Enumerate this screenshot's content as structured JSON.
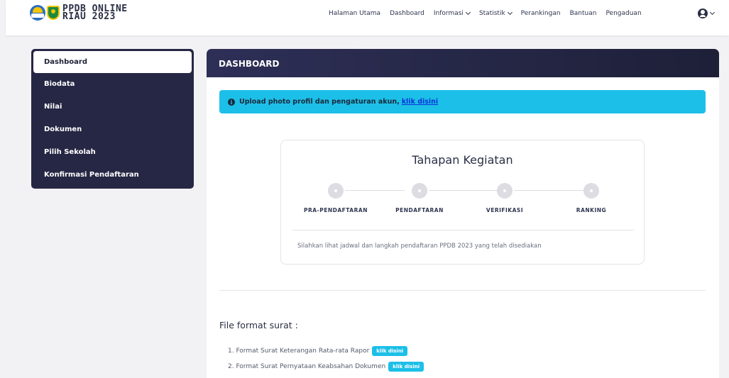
{
  "brand": {
    "line1": "PPDB ONLINE",
    "line2": "RIAU 2023"
  },
  "nav": {
    "items": [
      {
        "label": "Halaman Utama",
        "dropdown": false
      },
      {
        "label": "Dashboard",
        "dropdown": false
      },
      {
        "label": "Informasi",
        "dropdown": true
      },
      {
        "label": "Statistik",
        "dropdown": true
      },
      {
        "label": "Perankingan",
        "dropdown": false
      },
      {
        "label": "Bantuan",
        "dropdown": false
      },
      {
        "label": "Pengaduan",
        "dropdown": false
      }
    ]
  },
  "sidebar": {
    "items": [
      {
        "label": "Dashboard",
        "active": true
      },
      {
        "label": "Biodata",
        "active": false
      },
      {
        "label": "Nilai",
        "active": false
      },
      {
        "label": "Dokumen",
        "active": false
      },
      {
        "label": "Pilih Sekolah",
        "active": false
      },
      {
        "label": "Konfirmasi Pendaftaran",
        "active": false
      }
    ]
  },
  "main": {
    "header": "DASHBOARD",
    "alert": {
      "text": "Upload photo profil dan pengaturan akun,",
      "link": "klik disini"
    },
    "tahapan": {
      "title": "Tahapan Kegiatan",
      "steps": [
        "PRA-PENDAFTARAN",
        "PENDAFTARAN",
        "VERIFIKASI",
        "RANKING"
      ],
      "note": "Silahkan lihat jadwal dan langkah pendaftaran PPDB 2023 yang telah disediakan"
    },
    "files": {
      "title": "File format surat :",
      "items": [
        {
          "label": "1. Format Surat Keterangan Rata-rata Rapor",
          "button": "klik disini"
        },
        {
          "label": "2. Format Surat Pernyataan Keabsahan Dokumen",
          "button": "klik disini"
        }
      ]
    }
  },
  "colors": {
    "sidebar_bg": "#262744",
    "header_bg": "#2e2f57",
    "alert_bg": "#1cbfe8",
    "link": "#0b35d8"
  }
}
